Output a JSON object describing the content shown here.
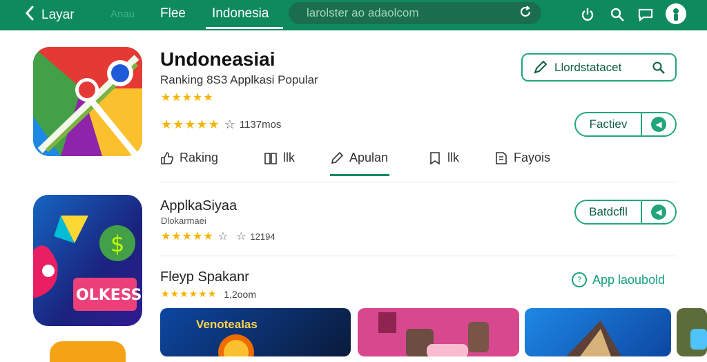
{
  "topbar": {
    "back_label": "Layar",
    "tabs": [
      {
        "label": "Anau"
      },
      {
        "label": "Flee"
      },
      {
        "label": "Indonesia"
      }
    ],
    "search_placeholder": "larolster ao adaolcom",
    "icons": [
      "power-icon",
      "search-icon",
      "chat-icon",
      "profile-icon"
    ]
  },
  "app": {
    "title": "Undoneasiai",
    "subtitle": "Ranking 8S3 Applkasi Popular",
    "stars_small": "★★★★★",
    "stars": "★★★★★",
    "empty_star": "☆",
    "rating_count": "1137mos",
    "search_button": "Llordstatacet",
    "action_button": "Factiev"
  },
  "subtabs": [
    {
      "label": "Raking",
      "icon": "thumbs-up-icon"
    },
    {
      "label": "llk",
      "icon": "book-icon"
    },
    {
      "label": "Apulan",
      "icon": "pen-icon"
    },
    {
      "label": "llk",
      "icon": "bookmark-icon"
    },
    {
      "label": "Fayois",
      "icon": "document-icon"
    }
  ],
  "app2": {
    "title": "ApplkaSiyaa",
    "subtitle": "Dlokarmaei",
    "stars": "★★★★★",
    "empty_star": "☆",
    "extra": "☆",
    "rating_count": "12194",
    "button": "Batdcfll",
    "icon_text": "OLKESS"
  },
  "section": {
    "title": "Fleyp Spakanr",
    "stars": "★★★★★★",
    "count": "1,2oom",
    "link_label": "App laoubold"
  },
  "thumbnails": [
    {
      "label": "Venotealas"
    },
    {
      "label": ""
    },
    {
      "label": ""
    }
  ],
  "colors": {
    "brand_green": "#0f8a5f",
    "accent_green": "#21a67a",
    "star": "#f4b400"
  }
}
